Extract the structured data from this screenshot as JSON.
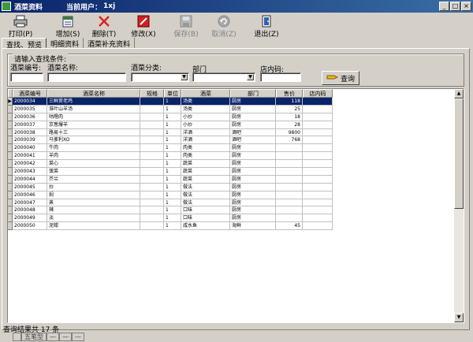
{
  "window": {
    "title": "酒菜资料",
    "user_label": "当前用户：",
    "user_value": "1xj",
    "minimize": "_",
    "maximize": "□",
    "close": "×"
  },
  "toolbar": {
    "print": "打印(P)",
    "add": "增加(S)",
    "delete": "删除(T)",
    "edit": "修改(X)",
    "save": "保存(B)",
    "cancel": "取消(Z)",
    "exit": "退出(Z)"
  },
  "tabs": [
    "查找、预览",
    "明细资料",
    "酒菜补充资料"
  ],
  "search": {
    "legend": "请输入查找条件:",
    "code_label": "酒菜编号:",
    "name_label": "酒菜名称:",
    "category_label": "酒菜分类:",
    "dept_label": "部门",
    "storecode_label": "店内码:",
    "query_button": "查询"
  },
  "grid": {
    "columns": [
      "酒菜编号",
      "酒菜名称",
      "规格",
      "单位",
      "酒菜",
      "部门",
      "售价",
      "店内码"
    ],
    "rows": [
      [
        "2000034",
        "三鲜煲老鸡",
        "",
        "1",
        "汤类",
        "厨房",
        "118",
        ""
      ],
      [
        "2000035",
        "淮叶山羊汤",
        "",
        "1",
        "汤类",
        "厨房",
        "25",
        ""
      ],
      [
        "2000036",
        "咕噜肉",
        "",
        "1",
        "小炒",
        "厨房",
        "18",
        ""
      ],
      [
        "2000037",
        "京葱爆羊",
        "",
        "1",
        "小炒",
        "厨房",
        "28",
        ""
      ],
      [
        "2000038",
        "路易十三",
        "",
        "1",
        "洋酒",
        "酒吧",
        "9800",
        ""
      ],
      [
        "2000039",
        "马爹利XO",
        "",
        "1",
        "洋酒",
        "酒吧",
        "768",
        ""
      ],
      [
        "2000040",
        "牛肉",
        "",
        "1",
        "肉类",
        "厨房",
        "",
        ""
      ],
      [
        "2000041",
        "羊肉",
        "",
        "1",
        "肉类",
        "厨房",
        "",
        ""
      ],
      [
        "2000042",
        "菜心",
        "",
        "1",
        "蔬菜",
        "厨房",
        "",
        ""
      ],
      [
        "2000043",
        "菠菜",
        "",
        "1",
        "蔬菜",
        "厨房",
        "",
        ""
      ],
      [
        "2000044",
        "芥兰",
        "",
        "1",
        "蔬菜",
        "厨房",
        "",
        ""
      ],
      [
        "2000045",
        "炒",
        "",
        "1",
        "做法",
        "厨房",
        "",
        ""
      ],
      [
        "2000046",
        "焖",
        "",
        "1",
        "做法",
        "厨房",
        "",
        ""
      ],
      [
        "2000047",
        "蒸",
        "",
        "1",
        "做法",
        "厨房",
        "",
        ""
      ],
      [
        "2000048",
        "辣",
        "",
        "1",
        "口味",
        "厨房",
        "",
        ""
      ],
      [
        "2000049",
        "淡",
        "",
        "1",
        "口味",
        "厨房",
        "",
        ""
      ],
      [
        "2000050",
        "泥蚶",
        "",
        "1",
        "咸水鱼",
        "海鲜",
        "45",
        ""
      ]
    ]
  },
  "status": {
    "text": "查询结果共 17 条"
  },
  "ime": {
    "mode": "五笔型",
    "b1": "—",
    "b2": "—",
    "b3": "—"
  },
  "colors": {
    "title_bar": "#0a246a",
    "selection": "#0a246a",
    "window_bg": "#d4d0c8"
  }
}
